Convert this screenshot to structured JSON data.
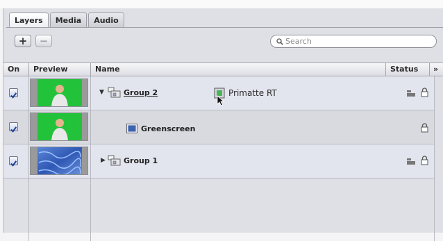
{
  "tabs": [
    {
      "label": "Layers",
      "active": true
    },
    {
      "label": "Media",
      "active": false
    },
    {
      "label": "Audio",
      "active": false
    }
  ],
  "toolbar": {
    "add_label": "+",
    "remove_label": "−",
    "search_placeholder": "Search"
  },
  "columns": {
    "on": "On",
    "preview": "Preview",
    "name": "Name",
    "status": "Status",
    "more": "»"
  },
  "rows": [
    {
      "name": "Group 2",
      "kind": "group",
      "expanded": true,
      "checked": true,
      "preview": "greenscreen",
      "filter": "Primatte RT",
      "status_icons": [
        "group-status-icon",
        "lock-icon"
      ]
    },
    {
      "name": "Greenscreen",
      "kind": "layer",
      "checked": true,
      "preview": "greenscreen",
      "status_icons": [
        "lock-icon"
      ]
    },
    {
      "name": "Group 1",
      "kind": "group",
      "expanded": false,
      "checked": true,
      "preview": "blue-pattern",
      "status_icons": [
        "group-status-icon",
        "lock-icon"
      ]
    }
  ],
  "colors": {
    "group_row": "#e3e5ee",
    "layer_row": "#d9dae0",
    "greenscreen": "#22c33a",
    "checkbox": "#3f6fc2"
  }
}
